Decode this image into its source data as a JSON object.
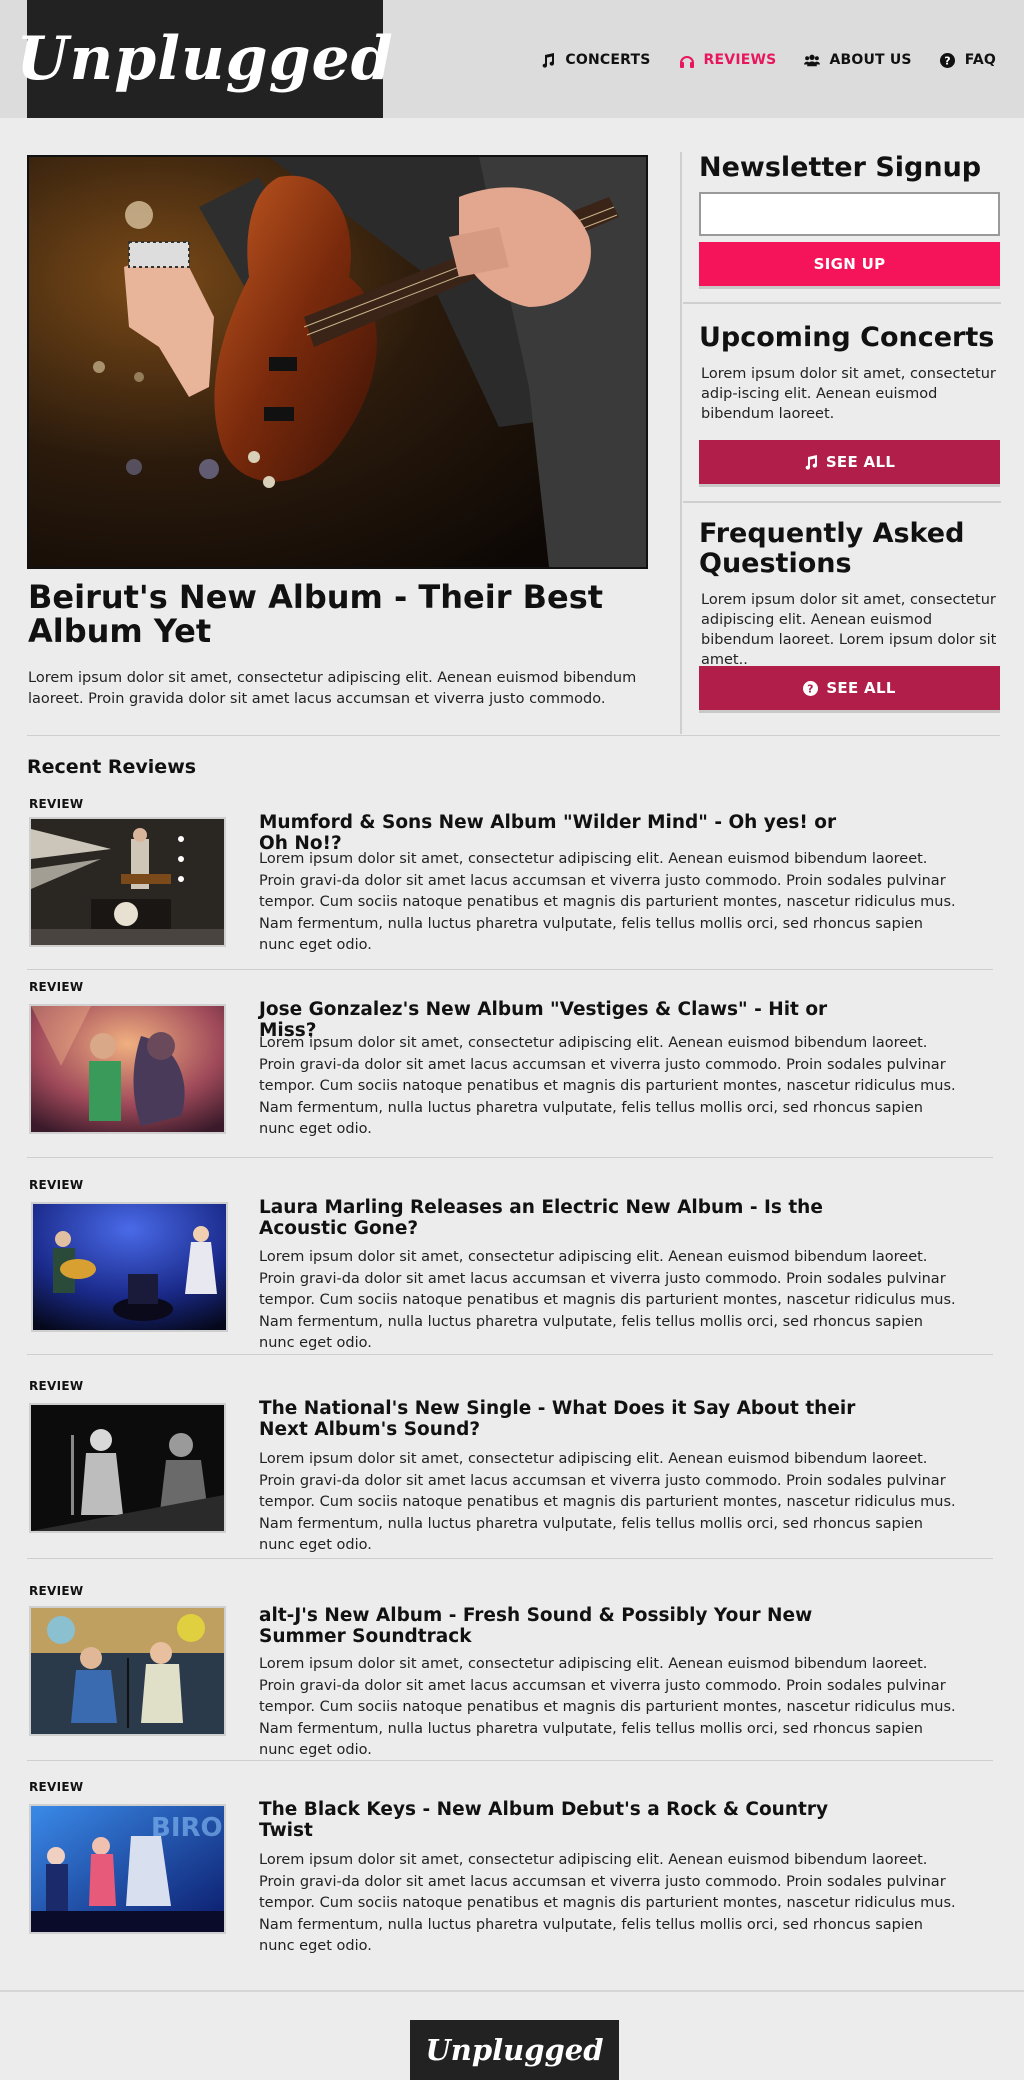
{
  "brand": {
    "logo_text": "Unplugged",
    "accent": "#e8175d",
    "button_red": "#b01e49",
    "button_pink": "#f5145a"
  },
  "nav": [
    {
      "label": "CONCERTS",
      "icon": "music-note-icon"
    },
    {
      "label": "REVIEWS",
      "icon": "headphones-icon",
      "active": true
    },
    {
      "label": "ABOUT US",
      "icon": "users-icon"
    },
    {
      "label": "FAQ",
      "icon": "question-circle-icon"
    }
  ],
  "feature": {
    "title": "Beirut's New Album - Their Best Album Yet",
    "text": "Lorem ipsum dolor sit amet, consectetur adipiscing elit. Aenean euismod bibendum laoreet. Proin gravida dolor sit amet lacus accumsan et viverra justo commodo."
  },
  "sidebar": {
    "newsletter": {
      "title": "Newsletter Signup",
      "input_value": "",
      "button": "SIGN UP"
    },
    "concerts": {
      "title": "Upcoming Concerts",
      "text": "Lorem ipsum dolor sit amet, consectetur adip-iscing elit. Aenean euismod bibendum laoreet.",
      "button": "SEE ALL"
    },
    "faq": {
      "title": "Frequently Asked Questions",
      "text": "Lorem ipsum dolor sit amet, consectetur adipiscing elit. Aenean euismod bibendum laoreet. Lorem ipsum dolor sit amet..",
      "button": "SEE ALL"
    }
  },
  "recent": {
    "heading": "Recent Reviews",
    "tag": "REVIEW",
    "body": "Lorem ipsum dolor sit amet, consectetur adipiscing elit. Aenean euismod bibendum laoreet. Proin gravi-da dolor sit amet lacus accumsan et viverra justo commodo. Proin sodales pulvinar tempor. Cum sociis natoque penatibus et magnis dis parturient montes, nascetur ridiculus mus. Nam fermentum, nulla luctus pharetra vulputate, felis tellus mollis orci, sed rhoncus sapien nunc eget odio.",
    "items": [
      {
        "title": "Mumford & Sons New Album \"Wilder Mind\" - Oh yes! or Oh No!?"
      },
      {
        "title": "Jose Gonzalez's New Album  \"Vestiges & Claws\" - Hit or Miss?"
      },
      {
        "title": "Laura Marling Releases an Electric New Album - Is the Acoustic Gone?"
      },
      {
        "title": "The National's New Single - What Does it Say About their Next Album's Sound?"
      },
      {
        "title": "alt-J's New Album - Fresh Sound & Possibly Your New Summer Soundtrack"
      },
      {
        "title": "The Black Keys - New Album Debut's a Rock & Country Twist"
      }
    ]
  },
  "footer": {
    "logo_text": "Unplugged"
  }
}
